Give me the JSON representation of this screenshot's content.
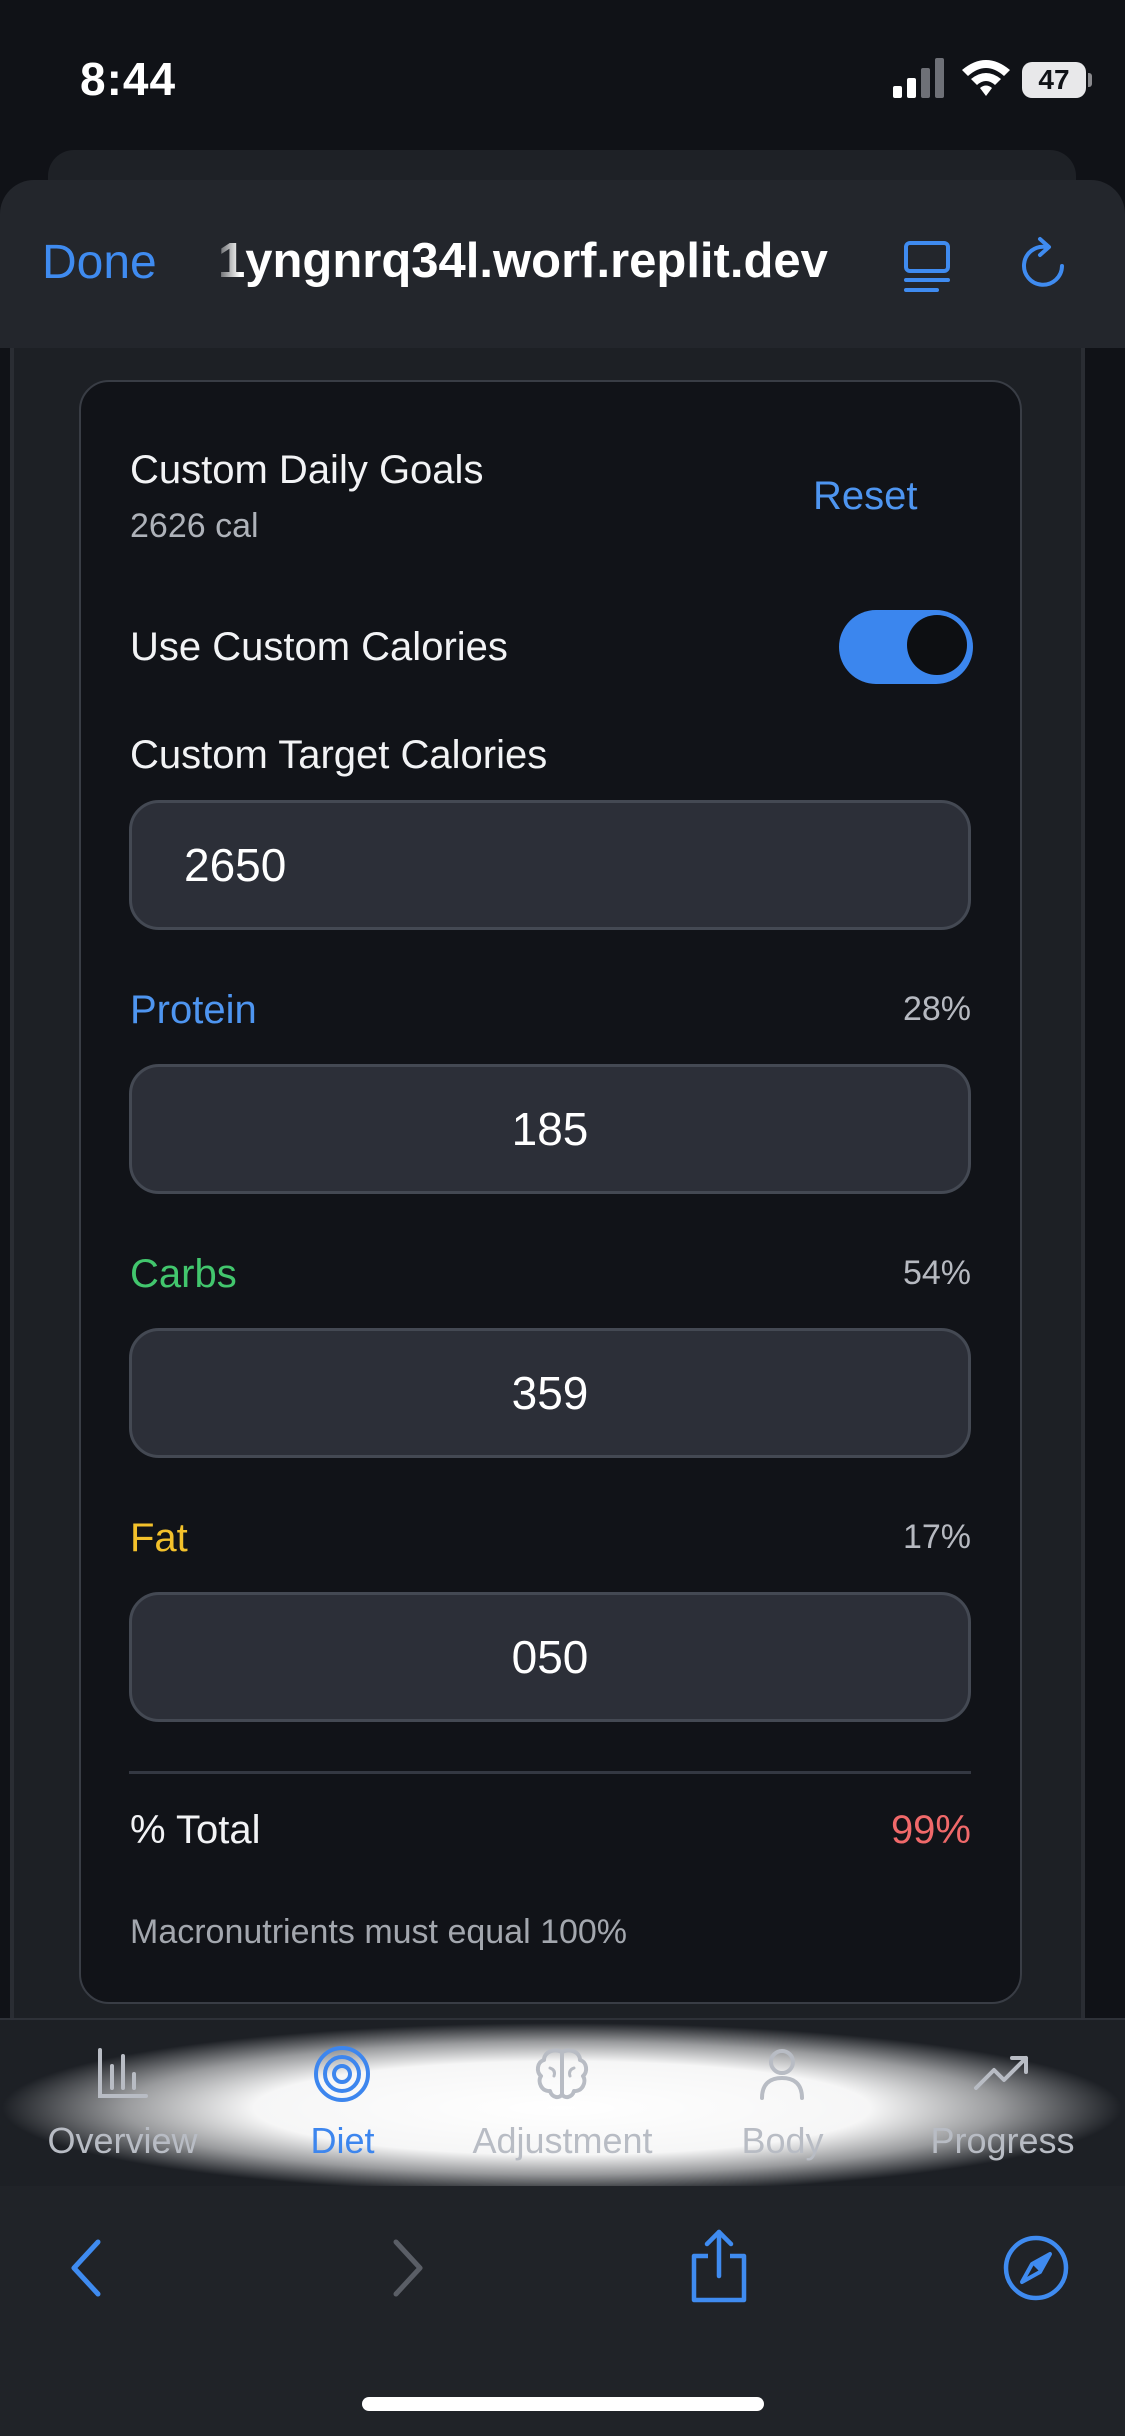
{
  "status_bar": {
    "time": "8:44",
    "battery": "47"
  },
  "browser": {
    "done_label": "Done",
    "url": "1yngnrq34l.worf.replit.dev"
  },
  "card": {
    "title": "Custom Daily Goals",
    "subtitle": "2626 cal",
    "reset_label": "Reset",
    "custom_calories_label": "Use Custom Calories",
    "custom_calories_enabled": true,
    "target_label": "Custom Target Calories",
    "target_value": "2650",
    "protein": {
      "label": "Protein",
      "percent": "28%",
      "value": "185",
      "color": "#4e95f0"
    },
    "carbs": {
      "label": "Carbs",
      "percent": "54%",
      "value": "359",
      "color": "#42c66d"
    },
    "fat": {
      "label": "Fat",
      "percent": "17%",
      "value": "050",
      "color": "#f3c12b"
    },
    "total_label": "% Total",
    "total_value": "99%",
    "total_color": "#f0696a",
    "hint": "Macronutrients must equal 100%"
  },
  "tabs": [
    {
      "label": "Overview",
      "icon": "bar-chart-icon",
      "active": false
    },
    {
      "label": "Diet",
      "icon": "target-icon",
      "active": true
    },
    {
      "label": "Adjustment",
      "icon": "brain-icon",
      "active": false
    },
    {
      "label": "Body",
      "icon": "user-icon",
      "active": false
    },
    {
      "label": "Progress",
      "icon": "trending-up-icon",
      "active": false
    }
  ],
  "colors": {
    "accent": "#3f8bf0",
    "background": "#101217",
    "card": "#111318"
  }
}
